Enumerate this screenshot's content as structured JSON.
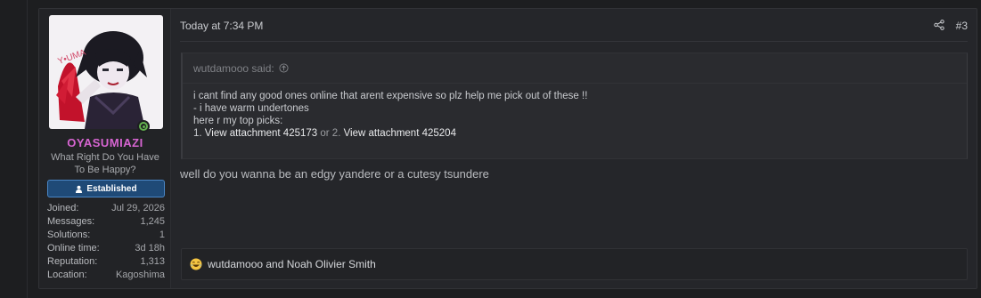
{
  "user": {
    "name": "OYASUMIAZI",
    "title": "What Right Do You Have To Be Happy?",
    "banner": "Established",
    "stats": [
      {
        "label": "Joined:",
        "value": "Jul 29, 2026"
      },
      {
        "label": "Messages:",
        "value": "1,245"
      },
      {
        "label": "Solutions:",
        "value": "1"
      },
      {
        "label": "Online time:",
        "value": "3d 18h"
      },
      {
        "label": "Reputation:",
        "value": "1,313"
      },
      {
        "label": "Location:",
        "value": "Kagoshima"
      }
    ],
    "online_color": "#63b24f",
    "name_color": "#d765d2"
  },
  "post": {
    "date": "Today at 7:34 PM",
    "number": "#3",
    "quote": {
      "author": "wutdamooo said:",
      "line1": "i cant find any good ones online that arent expensive so plz help me pick out of these !!",
      "line2": "- i have warm undertones",
      "line3": "here r my top picks:",
      "pick1_prefix": "1. ",
      "pick1": "View attachment 425173",
      "separator": " or 2. ",
      "pick2": "View attachment 425204"
    },
    "body": "well do you wanna be an edgy yandere or a cutesy tsundere",
    "reactions": {
      "emoji": "laughing-emoji",
      "text": "wutdamooo and Noah Olivier Smith"
    }
  }
}
